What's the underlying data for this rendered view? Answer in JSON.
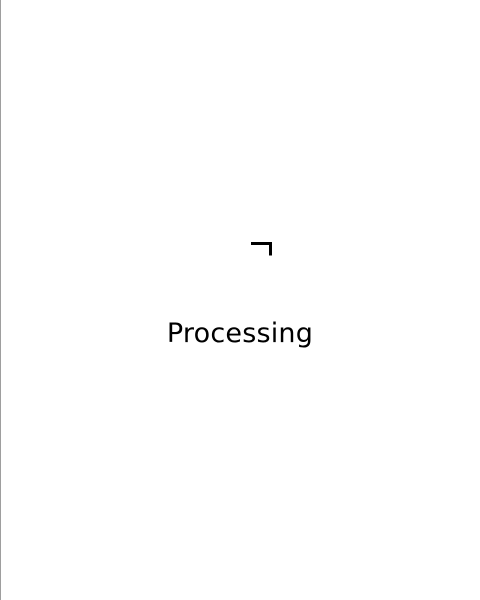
{
  "status": {
    "label": "Processing"
  },
  "spinner": {
    "icon": "spinner-icon",
    "color": "#000000"
  }
}
